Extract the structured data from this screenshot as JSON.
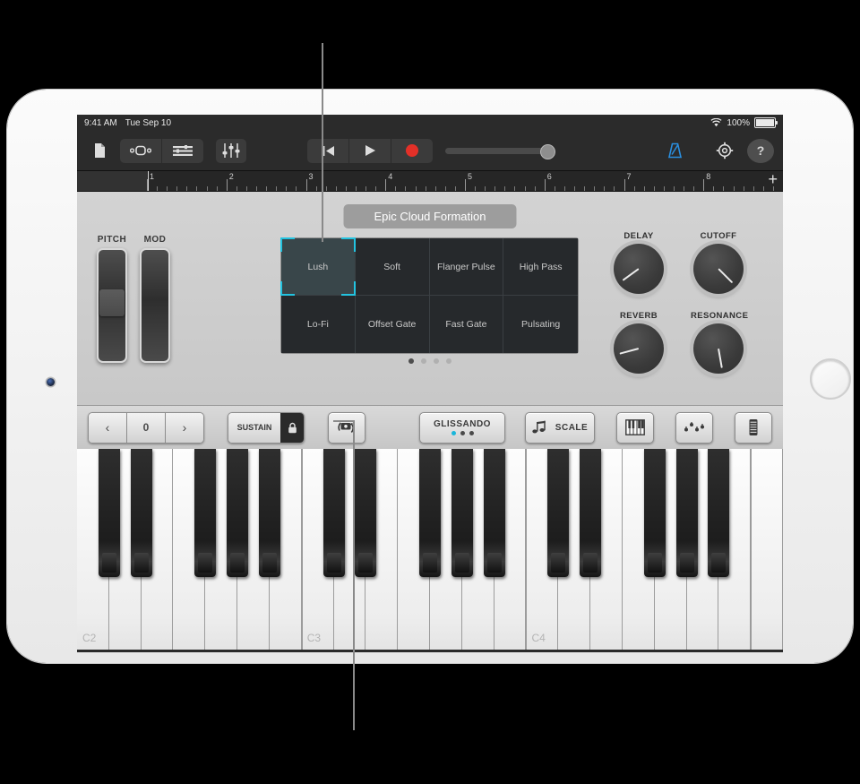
{
  "status_bar": {
    "time": "9:41 AM",
    "date": "Tue Sep 10",
    "battery_percent": "100%",
    "wifi_icon": "wifi-icon",
    "battery_icon": "battery-icon"
  },
  "toolbar": {
    "navigation_icon": "document-icon",
    "view_tracks_icon": "track-view-icon",
    "view_list_icon": "list-view-icon",
    "mixer_icon": "mixer-sliders-icon",
    "undo_icon": "undo-icon",
    "rewind_icon": "rewind-icon",
    "play_icon": "play-icon",
    "record_icon": "record-icon",
    "volume_label": "master-volume-slider",
    "metronome_icon": "metronome-icon",
    "settings_icon": "gear-icon",
    "help_label": "?",
    "metronome_color": "#2a8fe0",
    "record_color": "#e33028"
  },
  "ruler": {
    "bars": [
      "1",
      "2",
      "3",
      "4",
      "5",
      "6",
      "7",
      "8"
    ],
    "add_label": "+",
    "playhead_bar": "1"
  },
  "instrument": {
    "patch_name": "Epic Cloud Formation",
    "wheels": [
      {
        "label": "PITCH",
        "name": "pitch-wheel",
        "has_thumb": true
      },
      {
        "label": "MOD",
        "name": "mod-wheel",
        "has_thumb": false
      }
    ],
    "presets": [
      {
        "label": "Lush",
        "selected": true
      },
      {
        "label": "Soft",
        "selected": false
      },
      {
        "label": "Flanger Pulse",
        "selected": false
      },
      {
        "label": "High Pass",
        "selected": false
      },
      {
        "label": "Lo-Fi",
        "selected": false
      },
      {
        "label": "Offset Gate",
        "selected": false
      },
      {
        "label": "Fast Gate",
        "selected": false
      },
      {
        "label": "Pulsating",
        "selected": false
      }
    ],
    "selection_color": "#23c3e0",
    "page_dots": {
      "count": 4,
      "active_index": 0
    },
    "knobs": [
      {
        "label": "DELAY",
        "angle_deg": -126
      },
      {
        "label": "CUTOFF",
        "angle_deg": 135
      },
      {
        "label": "REVERB",
        "angle_deg": -105
      },
      {
        "label": "RESONANCE",
        "angle_deg": 170
      }
    ]
  },
  "keyboard_controls": {
    "octave_down_label": "‹",
    "octave_value": "0",
    "octave_up_label": "›",
    "sustain_label": "SUSTAIN",
    "sustain_lock_icon": "lock-icon",
    "arpeggiator_icon": "rotate-keyboard-icon",
    "glissando_label": "GLISSANDO",
    "glissando_dots": {
      "count": 3,
      "active_index": 0
    },
    "glissando_active_color": "#1ab6da",
    "scale_label": "SCALE",
    "scale_icon": "music-notes-icon",
    "keyboard_layout_icon": "piano-keys-icon",
    "arpeggio_notes_icon": "arpeggio-notes-icon",
    "key_size_icon": "keyboard-size-icon"
  },
  "piano": {
    "octave_labels": [
      "C2",
      "C3",
      "C4"
    ],
    "white_key_count": 22,
    "black_key_pattern": [
      0,
      1,
      3,
      4,
      5
    ]
  }
}
